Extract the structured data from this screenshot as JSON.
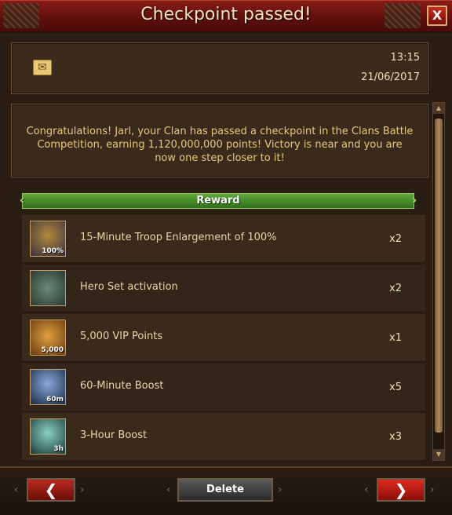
{
  "window": {
    "title": "Checkpoint passed!",
    "close_label": "X"
  },
  "mail": {
    "icon": "envelope-icon",
    "time": "13:15",
    "date": "21/06/2017"
  },
  "message": "Congratulations! Jarl, your Clan has passed a checkpoint in the Clans Battle Competition, earning 1,120,000,000 points! Victory is near and you are now one step closer to it!",
  "reward_header": "Reward",
  "rewards": [
    {
      "name": "15-Minute Troop Enlargement of 100%",
      "qty": "x2",
      "badge": "100%",
      "icon": "troop-enlargement-icon"
    },
    {
      "name": "Hero Set activation",
      "qty": "x2",
      "badge": "",
      "icon": "hero-set-icon"
    },
    {
      "name": "5,000 VIP Points",
      "qty": "x1",
      "badge": "5,000",
      "icon": "vip-points-icon"
    },
    {
      "name": "60-Minute Boost",
      "qty": "x5",
      "badge": "60m",
      "icon": "hourglass-boost-icon"
    },
    {
      "name": "3-Hour Boost",
      "qty": "x3",
      "badge": "3h",
      "icon": "hourglass-boost-icon"
    }
  ],
  "footer": {
    "prev_label": "❮",
    "delete_label": "Delete",
    "next_label": "❯"
  }
}
